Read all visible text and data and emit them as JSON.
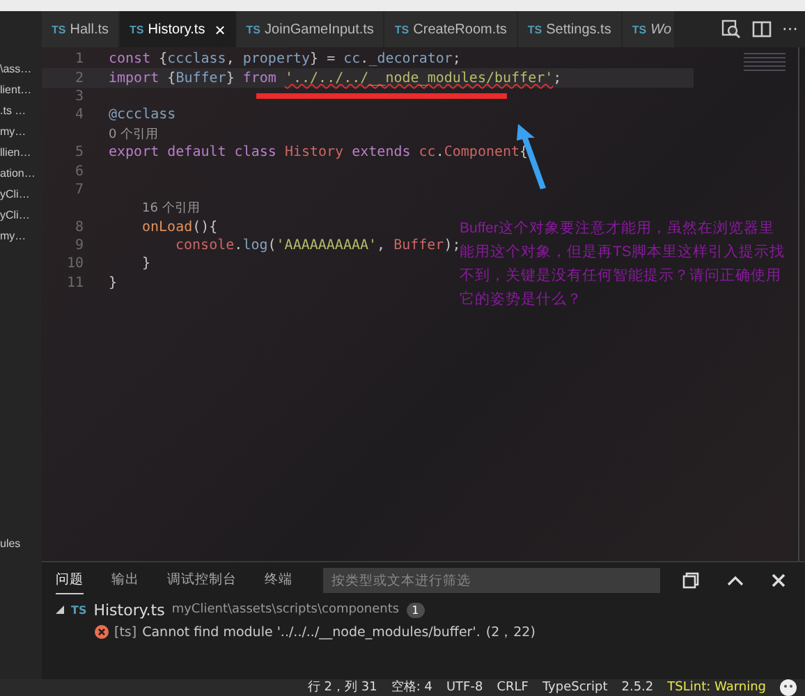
{
  "sidebar": {
    "items": [
      "\\ass…",
      "lient…",
      ".ts …",
      "my…",
      "llien…",
      "ation…",
      "yCli…",
      "yCli…",
      "my…"
    ],
    "bottom_item": "ules"
  },
  "tabs": [
    {
      "label": "Hall.ts",
      "icon": "TS",
      "selected": false
    },
    {
      "label": "History.ts",
      "icon": "TS",
      "selected": true,
      "close": "×"
    },
    {
      "label": "JoinGameInput.ts",
      "icon": "TS",
      "selected": false
    },
    {
      "label": "CreateRoom.ts",
      "icon": "TS",
      "selected": false
    },
    {
      "label": "Settings.ts",
      "icon": "TS",
      "selected": false
    },
    {
      "label": "Wo",
      "icon": "TS",
      "selected": false
    }
  ],
  "tab_actions": {
    "more": "···"
  },
  "editor": {
    "lines": [
      {
        "kind": "code",
        "number": "1",
        "current": false,
        "tokens": [
          {
            "text": "const ",
            "kind": "keyword"
          },
          {
            "text": "{",
            "kind": "punct"
          },
          {
            "text": "ccclass",
            "kind": "variable"
          },
          {
            "text": ", ",
            "kind": "punct"
          },
          {
            "text": "property",
            "kind": "variable"
          },
          {
            "text": "} = ",
            "kind": "punct"
          },
          {
            "text": "cc",
            "kind": "variable"
          },
          {
            "text": ".",
            "kind": "punct"
          },
          {
            "text": "_decorator",
            "kind": "variable"
          },
          {
            "text": ";",
            "kind": "punct"
          }
        ]
      },
      {
        "kind": "code",
        "number": "2",
        "current": true,
        "tokens": [
          {
            "text": "import ",
            "kind": "keyword"
          },
          {
            "text": "{",
            "kind": "punct"
          },
          {
            "text": "Buffer",
            "kind": "variable"
          },
          {
            "text": "} ",
            "kind": "punct"
          },
          {
            "text": "from ",
            "kind": "keyword"
          },
          {
            "text": "'../../../__node_modules/buffer'",
            "kind": "error"
          },
          {
            "text": ";",
            "kind": "punct"
          }
        ]
      },
      {
        "kind": "code",
        "number": "3",
        "current": false
      },
      {
        "kind": "code",
        "number": "4",
        "current": false,
        "tokens": [
          {
            "text": "@ccclass",
            "kind": "variable"
          }
        ]
      },
      {
        "kind": "lens",
        "text": "0 个引用"
      },
      {
        "kind": "code",
        "number": "5",
        "current": false,
        "tokens": [
          {
            "text": "export default class ",
            "kind": "keyword"
          },
          {
            "text": "History",
            "kind": "class"
          },
          {
            "text": " extends ",
            "kind": "keyword"
          },
          {
            "text": "cc",
            "kind": "class"
          },
          {
            "text": ".",
            "kind": "punct"
          },
          {
            "text": "Component",
            "kind": "class"
          },
          {
            "text": "{",
            "kind": "punct"
          }
        ],
        "children": [
          {
            "kind": "code",
            "number": "6",
            "current": false
          },
          {
            "kind": "code",
            "number": "7",
            "current": false
          },
          {
            "kind": "lens",
            "text": "16 个引用"
          },
          {
            "kind": "code",
            "number": "8",
            "current": false,
            "tokens": [
              {
                "text": "onLoad",
                "kind": "function"
              },
              {
                "text": "(){",
                "kind": "punct"
              }
            ],
            "children": [
              {
                "kind": "code",
                "number": "9",
                "current": false,
                "tokens": [
                  {
                    "text": "console",
                    "kind": "class"
                  },
                  {
                    "text": ".",
                    "kind": "punct"
                  },
                  {
                    "text": "log",
                    "kind": "variable"
                  },
                  {
                    "text": "(",
                    "kind": "punct"
                  },
                  {
                    "text": "'AAAAAAAAAA'",
                    "kind": "string"
                  },
                  {
                    "text": ", ",
                    "kind": "punct"
                  },
                  {
                    "text": "Buffer",
                    "kind": "class"
                  },
                  {
                    "text": ");",
                    "kind": "punct"
                  }
                ]
              }
            ]
          },
          {
            "kind": "code",
            "number": "10",
            "current": false,
            "tokens": [
              {
                "text": "}",
                "kind": "punct"
              }
            ]
          }
        ]
      },
      {
        "kind": "code",
        "number": "11",
        "current": false,
        "tokens": [
          {
            "text": "}",
            "kind": "punct"
          }
        ]
      }
    ],
    "annotation": "Buffer这个对象要注意才能用，虽然在浏览器里能用这个对象，但是再TS脚本里这样引入提示找不到，关键是没有任何智能提示？请问正确使用它的姿势是什么？"
  },
  "panel": {
    "tabs": [
      {
        "label": "问题",
        "selected": true
      },
      {
        "label": "输出",
        "selected": false
      },
      {
        "label": "调试控制台",
        "selected": false
      },
      {
        "label": "终端",
        "selected": false
      }
    ],
    "filter": {
      "placeholder": "按类型或文本进行筛选"
    },
    "problems": [
      {
        "file_icon": "TS",
        "file": "History.ts",
        "path": "myClient\\assets\\scripts\\components",
        "count": "1",
        "expanded": true,
        "items": [
          {
            "source": "[ts]",
            "message": "Cannot find module '../../../__node_modules/buffer'.",
            "location": "(2，22)"
          }
        ]
      }
    ]
  },
  "status_bar": {
    "items": [
      {
        "text": "行 2，列 31",
        "kind": "plain"
      },
      {
        "text": "空格: 4",
        "kind": "plain"
      },
      {
        "text": "UTF-8",
        "kind": "plain"
      },
      {
        "text": "CRLF",
        "kind": "plain"
      },
      {
        "text": "TypeScript",
        "kind": "plain"
      },
      {
        "text": "2.5.2",
        "kind": "plain"
      },
      {
        "text": "TSLint: Warning",
        "kind": "warning"
      }
    ]
  }
}
